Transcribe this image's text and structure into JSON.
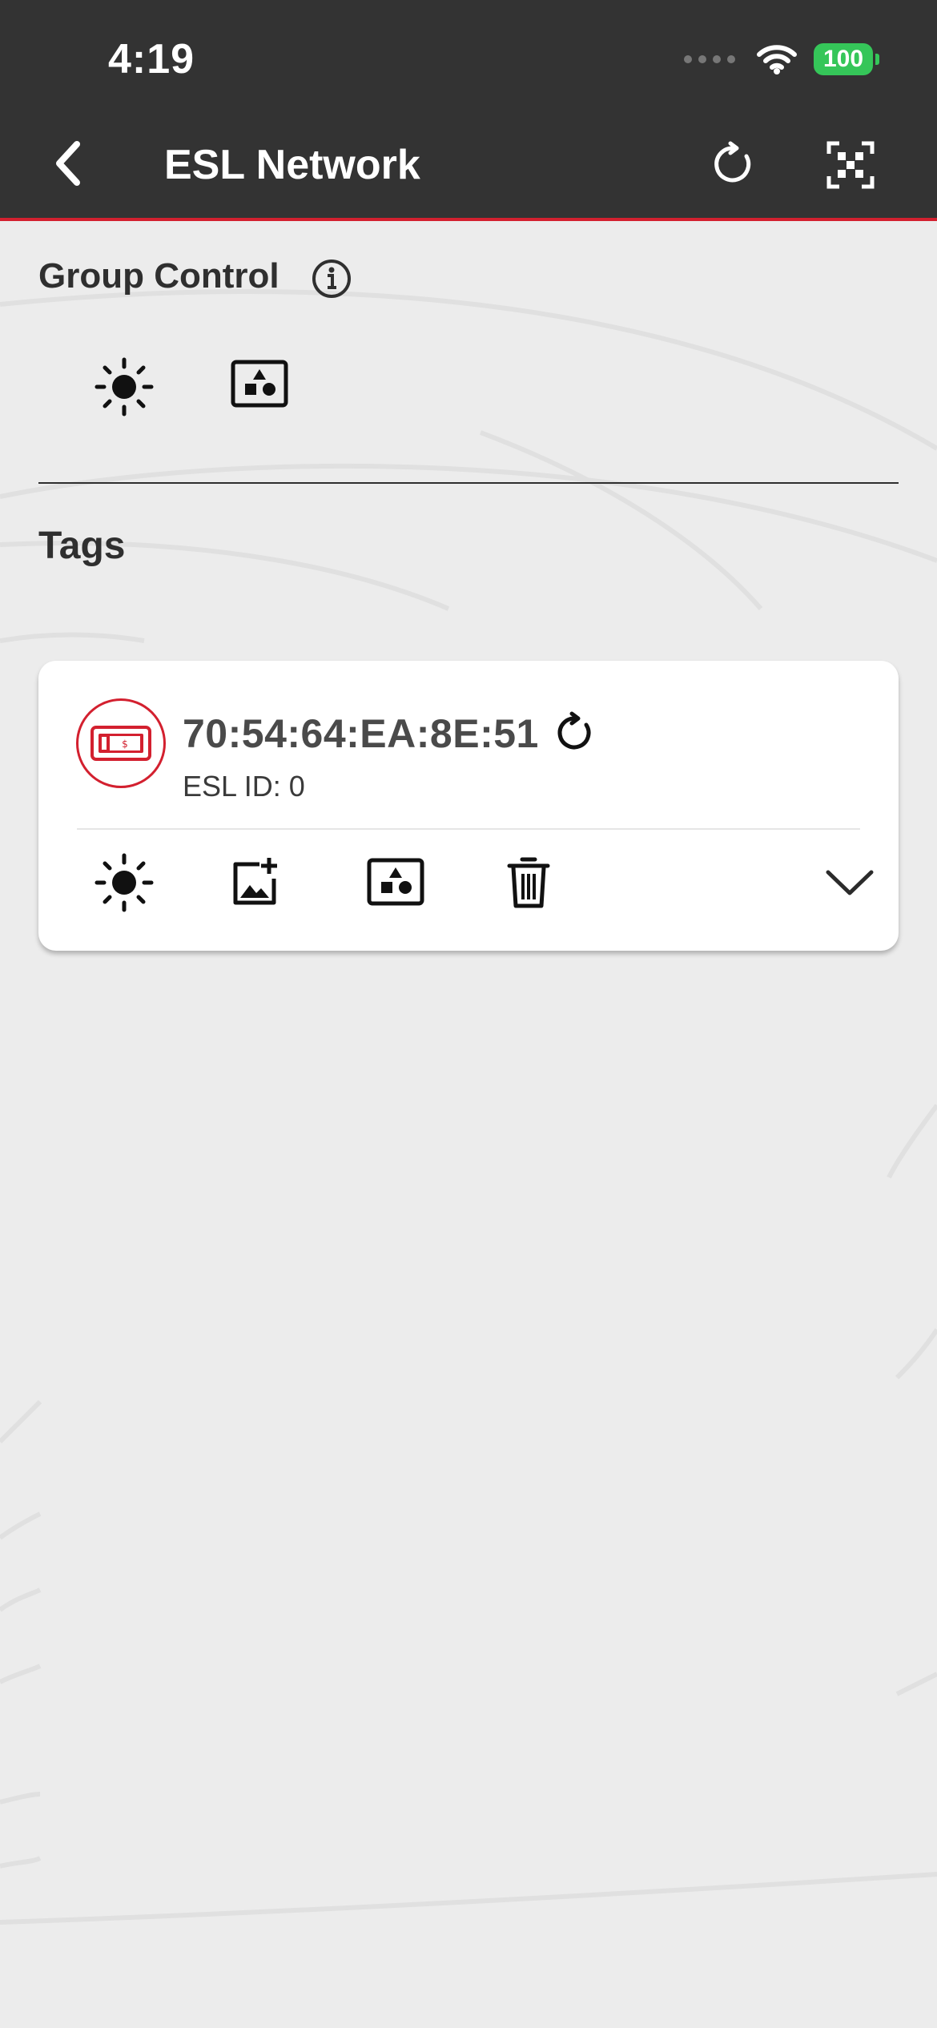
{
  "status_bar": {
    "time": "4:19",
    "battery": "100",
    "icons": [
      "signal-dots-icon",
      "wifi-icon",
      "battery-icon"
    ]
  },
  "nav": {
    "title": "ESL Network",
    "icons": [
      "back-chevron-icon",
      "refresh-icon",
      "qr-scan-icon"
    ]
  },
  "group_control": {
    "title": "Group Control",
    "actions": [
      "brightness-icon",
      "shapes-image-icon"
    ],
    "info_icon": "info-icon"
  },
  "tags_section": {
    "title": "Tags",
    "items": [
      {
        "mac": "70:54:64:EA:8E:51",
        "esl_id": "ESL ID: 0",
        "icon": "price-tag-icon",
        "actions": [
          "brightness-icon",
          "add-image-icon",
          "shapes-image-icon",
          "trash-icon",
          "chevron-down-icon"
        ]
      }
    ]
  },
  "colors": {
    "header_bg": "#333333",
    "accent_red": "#d3202f",
    "battery_green": "#35c659",
    "page_bg": "#ececec"
  }
}
